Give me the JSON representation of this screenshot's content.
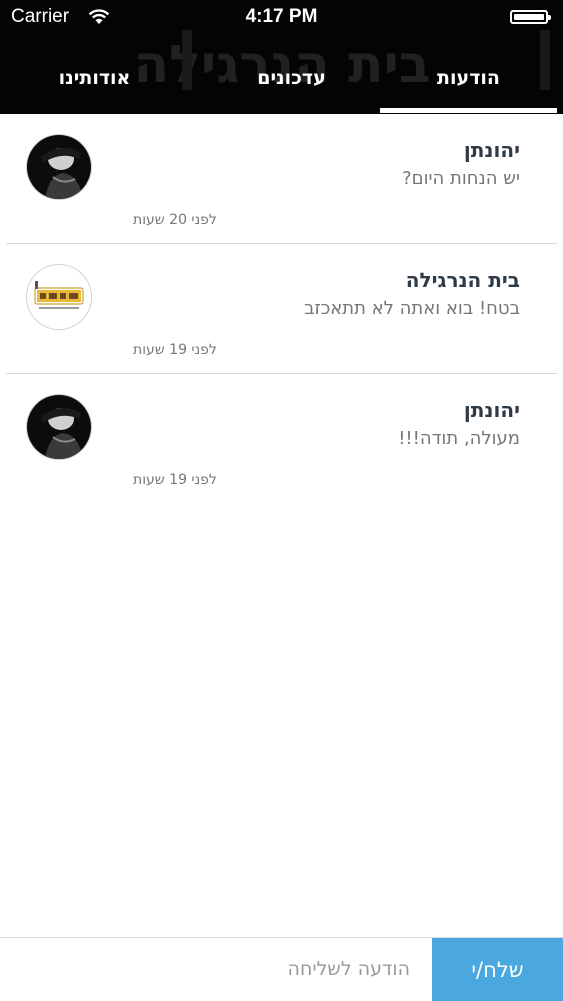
{
  "status_bar": {
    "carrier": "Carrier",
    "time": "4:17 PM"
  },
  "header": {
    "brand_watermark": "בית הנרגילה",
    "tabs": [
      {
        "label": "הודעות",
        "active": true
      },
      {
        "label": "עדכונים",
        "active": false
      },
      {
        "label": "אודותינו",
        "active": false
      }
    ]
  },
  "messages": [
    {
      "sender": "יהונתן",
      "text": "יש הנחות היום?",
      "time": "לפני 20 שעות",
      "avatar": "user-avatar-dark"
    },
    {
      "sender": "בית הנרגילה",
      "text": "בטח! בוא ואתה לא תתאכזב",
      "time": "לפני 19 שעות",
      "avatar": "brand-logo"
    },
    {
      "sender": "יהונתן",
      "text": "מעולה, תודה!!!",
      "time": "לפני 19 שעות",
      "avatar": "user-avatar-dark"
    }
  ],
  "composer": {
    "placeholder": "הודעה לשליחה",
    "send_label": "שלח/י"
  },
  "colors": {
    "header_bg": "#040404",
    "accent": "#4aa8de",
    "sender_text": "#2e3a46",
    "message_text": "#767676"
  }
}
